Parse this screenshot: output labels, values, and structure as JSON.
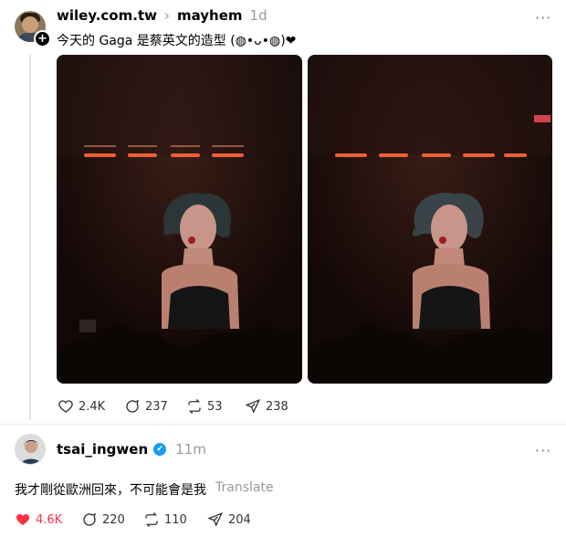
{
  "post1": {
    "username": "wiley.com.tw",
    "separator": "›",
    "topic": "mayhem",
    "time": "1d",
    "text": "今天的 Gaga 是蔡英文的造型 (◍•ᴗ•◍)❤",
    "more": "···",
    "actions": {
      "likes": "2.4K",
      "replies": "237",
      "reposts": "53",
      "shares": "238"
    },
    "icons": {
      "like": "heart-icon",
      "reply": "comment-icon",
      "repost": "repost-icon",
      "share": "share-icon",
      "follow": "plus-icon"
    }
  },
  "post2": {
    "username": "tsai_ingwen",
    "time": "11m",
    "text": "我才剛從歐洲回來，不可能會是我",
    "translate": "Translate",
    "more": "···",
    "actions": {
      "likes": "4.6K",
      "replies": "220",
      "reposts": "110",
      "shares": "204"
    },
    "like_color": "#ff3040",
    "verified_color": "#1d9bf0"
  }
}
